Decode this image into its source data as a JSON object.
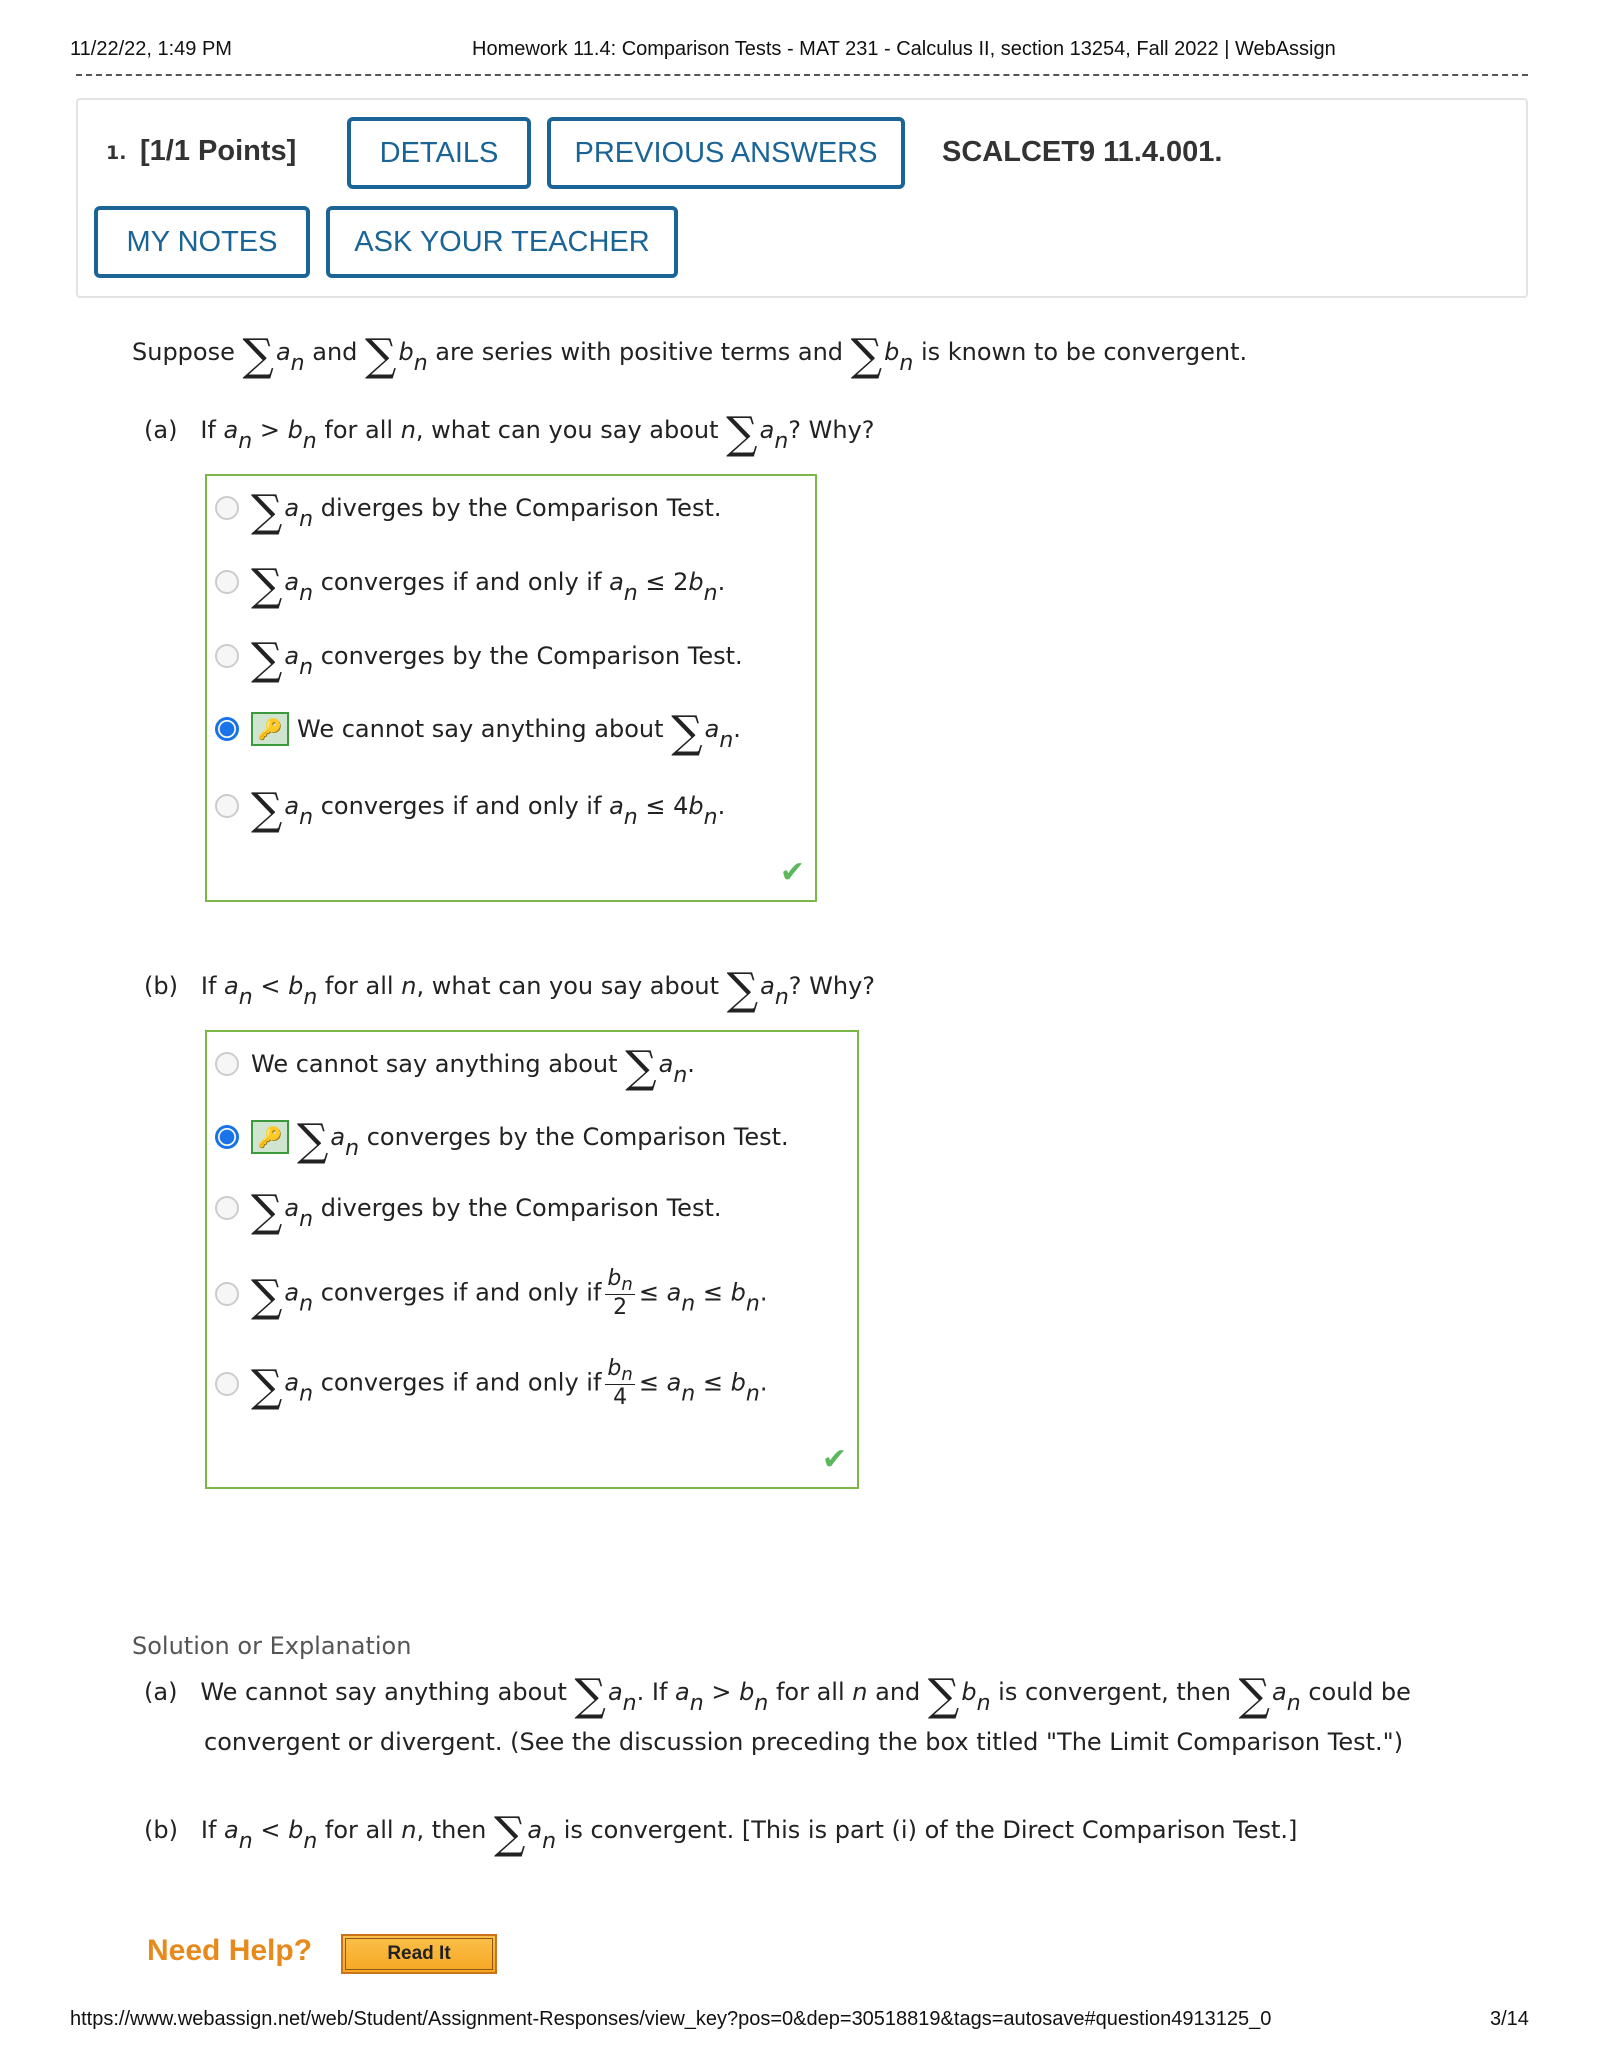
{
  "print_header": {
    "datetime": "11/22/22, 1:49 PM",
    "title": "Homework 11.4: Comparison Tests - MAT 231 - Calculus II, section 13254, Fall 2022 | WebAssign"
  },
  "question": {
    "number": "1.",
    "points": "[1/1 Points]",
    "buttons": {
      "details": "DETAILS",
      "previous_answers": "PREVIOUS ANSWERS",
      "my_notes": "MY NOTES",
      "ask_teacher": "ASK YOUR TEACHER"
    },
    "id": "SCALCET9 11.4.001.",
    "accent_color": "#1a6496"
  },
  "prompt": {
    "w1": "Suppose",
    "w2": "and",
    "w3": "are series with positive terms and",
    "w4": "is known to be convergent.",
    "sigma": "∑",
    "a": "a",
    "b": "b",
    "n": "n"
  },
  "part_a": {
    "label": "(a)",
    "q1": "If",
    "op": ">",
    "q2": "for all",
    "q3": ", what can you say about",
    "q4": "? Why?",
    "options": [
      {
        "text": "diverges by the Comparison Test.",
        "selected": false
      },
      {
        "text": "converges if and only if",
        "tail_coef": "2",
        "selected": false
      },
      {
        "text": "converges by the Comparison Test.",
        "selected": false
      },
      {
        "text": "We cannot say anything about",
        "selected": true,
        "correct": true
      },
      {
        "text": "converges if and only if",
        "tail_coef": "4",
        "selected": false
      }
    ],
    "result": "correct"
  },
  "part_b": {
    "label": "(b)",
    "q1": "If",
    "op": "<",
    "q2": "for all",
    "q3": ", what can you say about",
    "q4": "? Why?",
    "options": [
      {
        "text": "We cannot say anything about",
        "selected": false
      },
      {
        "text": "converges by the Comparison Test.",
        "selected": true,
        "correct": true
      },
      {
        "text": "diverges by the Comparison Test.",
        "selected": false
      },
      {
        "text": "converges if and only if",
        "den": "2",
        "selected": false
      },
      {
        "text": "converges if and only if",
        "den": "4",
        "selected": false
      }
    ],
    "result": "correct"
  },
  "symbols": {
    "le": "≤",
    "period": ".",
    "check": "✔",
    "key": "🔑"
  },
  "solution": {
    "title": "Solution or Explanation",
    "a_label": "(a)",
    "a_1": "We cannot say anything about",
    "a_2": ". If",
    "a_3": "for all",
    "a_4": "and",
    "a_5": "is convergent, then",
    "a_6": "could be",
    "a_line2": "convergent or divergent. (See the discussion preceding the box titled \"The Limit Comparison Test.\")",
    "b_label": "(b)",
    "b_1": "If",
    "b_2": "for all",
    "b_3": ", then",
    "b_4": "is convergent. [This is part (i) of the Direct Comparison Test.]"
  },
  "help": {
    "need_help": "Need Help?",
    "read_it": "Read It"
  },
  "print_footer": {
    "url": "https://www.webassign.net/web/Student/Assignment-Responses/view_key?pos=0&dep=30518819&tags=autosave#question4913125_0",
    "page": "3/14"
  }
}
